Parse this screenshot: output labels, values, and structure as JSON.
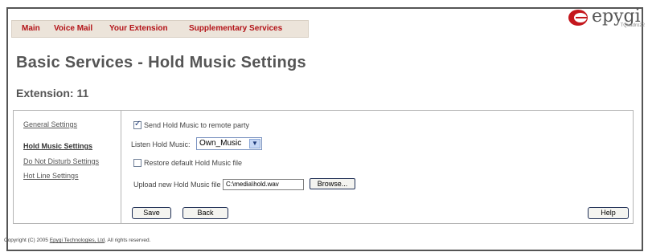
{
  "nav": {
    "items": [
      "Main",
      "Voice Mail",
      "Your Extension",
      "Supplementary Services"
    ]
  },
  "logo": {
    "text": "epygi",
    "subtitle": "TQuadro22"
  },
  "page": {
    "title": "Basic Services - Hold Music Settings",
    "extension": "Extension: 11"
  },
  "sidebar": {
    "items": [
      "General Settings",
      "Hold Music Settings",
      "Do Not Disturb Settings",
      "Hot Line Settings"
    ],
    "active": "Hold Music Settings"
  },
  "form": {
    "send_hold_music_label": "Send Hold Music to remote party",
    "send_hold_music_checked": true,
    "listen_label": "Listen Hold Music:",
    "listen_value": "Own_Music",
    "restore_label": "Restore default Hold Music file",
    "restore_checked": false,
    "upload_label": "Upload new Hold Music file",
    "upload_value": "C:\\media\\hold.wav",
    "browse_label": "Browse..."
  },
  "buttons": {
    "save": "Save",
    "back": "Back",
    "help": "Help"
  },
  "footer": {
    "prefix": "Copyright (C) 2005 ",
    "company_link": "Epygi Technologies, Ltd",
    "suffix": ". All rights reserved."
  },
  "colors": {
    "accent": "#b31217",
    "nav_bg": "#ece4da"
  }
}
